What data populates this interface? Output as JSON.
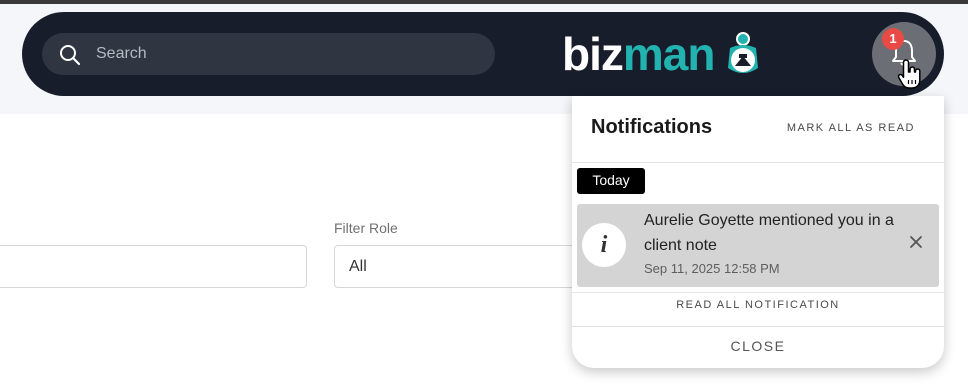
{
  "search": {
    "placeholder": "Search"
  },
  "logo": {
    "part1": "biz",
    "part2": "man"
  },
  "notifications_button": {
    "badge_count": "1"
  },
  "filters": {
    "role_label": "Filter Role",
    "role_value": "All"
  },
  "notification_panel": {
    "title": "Notifications",
    "mark_all_label": "MARK ALL AS READ",
    "group_label": "Today",
    "items": [
      {
        "message": "Aurelie Goyette mentioned you in a client note",
        "timestamp": "Sep 11, 2025 12:58 PM",
        "icon": "info-icon"
      }
    ],
    "read_all_label": "READ ALL NOTIFICATION",
    "close_label": "CLOSE"
  },
  "colors": {
    "navbar": "#171d2a",
    "brand_teal": "#22b3b0",
    "badge": "#e84b45",
    "notification_item": "#d4d4d4"
  }
}
